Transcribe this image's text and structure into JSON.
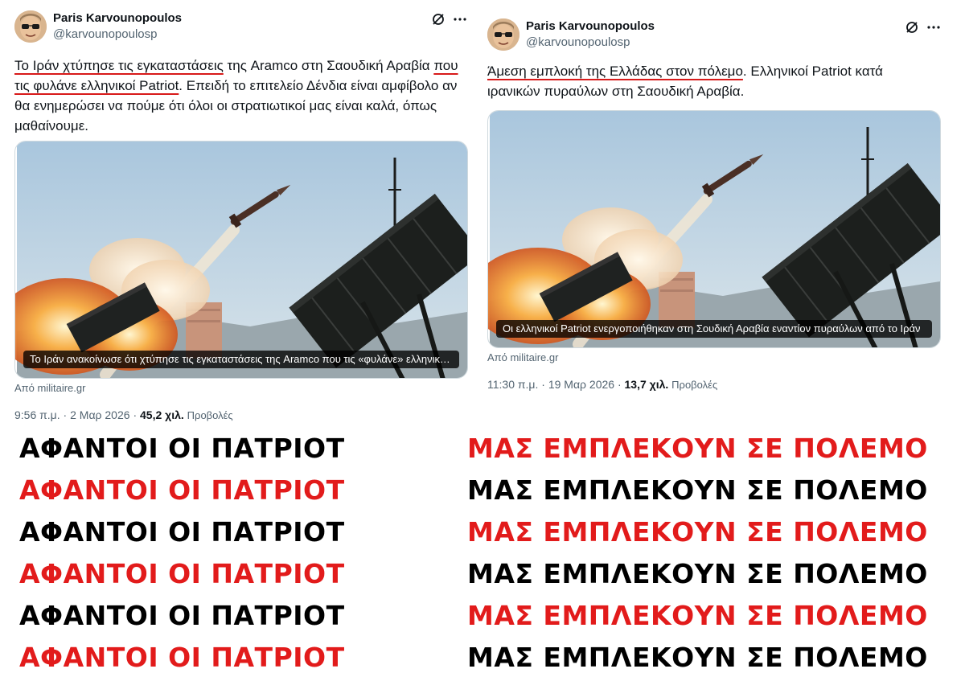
{
  "tweets": [
    {
      "author_name": "Paris Karvounopoulos",
      "handle": "@karvounopoulosp",
      "text_segments": [
        {
          "text": "Το Ιράν χτύπησε τις εγκαταστάσεις",
          "underline": true
        },
        {
          "text": " της Aramco στη Σαουδική Αραβία ",
          "underline": false
        },
        {
          "text": "που τις φυλάνε ελληνικοί Patriot",
          "underline": true
        },
        {
          "text": ". Επειδή το επιτελείο Δένδια είναι αμφίβολο αν θα ενημερώσει να πούμε ότι όλοι οι στρατιωτικοί μας είναι καλά, όπως μαθαίνουμε.",
          "underline": false
        }
      ],
      "media_caption": "Το Ιράν ανακοίνωσε ότι χτύπησε τις εγκαταστάσεις της Aramco που τις «φυλάνε» ελληνικοί Patriot",
      "source": "Από militaire.gr",
      "time": "9:56 π.μ.",
      "date": "2 Μαρ 2026",
      "views_count": "45,2 χιλ.",
      "views_label": "Προβολές"
    },
    {
      "author_name": "Paris Karvounopoulos",
      "handle": "@karvounopoulosp",
      "text_segments": [
        {
          "text": "Άμεση εμπλοκή της Ελλάδας στον πόλεμο",
          "underline": true
        },
        {
          "text": ". Ελληνικοί Patriot κατά ιρανικών πυραύλων στη Σαουδική Αραβία.",
          "underline": false
        }
      ],
      "media_caption": "Οι ελληνικοί Patriot ενεργοποιήθηκαν στη Σουδική Αραβία εναντίον πυραύλων από το Ιράν",
      "source": "Από militaire.gr",
      "time": "11:30 π.μ.",
      "date": "19 Μαρ 2026",
      "views_count": "13,7 χιλ.",
      "views_label": "Προβολές"
    }
  ],
  "icons": {
    "grok": "grok-slash-circle-icon",
    "more": "more-horizontal-icon"
  },
  "slogans": {
    "left_text": "ΑΦΑΝΤΟΙ ΟΙ ΠΑΤΡΙΟΤ",
    "right_text": "ΜΑΣ ΕΜΠΛΕΚΟΥΝ ΣΕ ΠΟΛΕΜΟ",
    "left_colors": [
      "black",
      "red",
      "black",
      "red",
      "black",
      "red"
    ],
    "right_colors": [
      "red",
      "black",
      "red",
      "black",
      "red",
      "black"
    ]
  },
  "colors": {
    "underline_red": "#d81a1a",
    "slogan_red": "#e21b1b",
    "slogan_black": "#000000",
    "secondary_text": "#536471"
  }
}
